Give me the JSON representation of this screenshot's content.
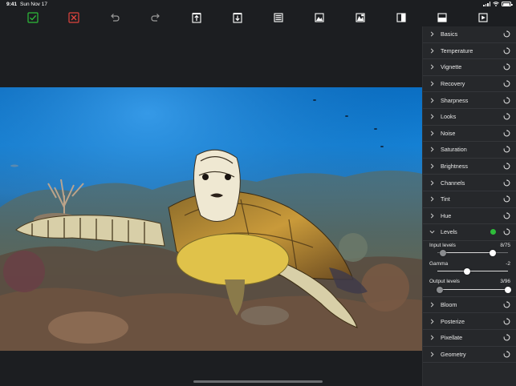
{
  "status_bar": {
    "time": "9:41",
    "date": "Sun Nov 17",
    "battery_level": 0.9
  },
  "toolbar": {
    "buttons": [
      {
        "name": "confirm-button",
        "icon": "checkmark-square-icon",
        "color": "#2ebd3a"
      },
      {
        "name": "cancel-button",
        "icon": "x-square-icon",
        "color": "#e0443e"
      },
      {
        "name": "undo-button",
        "icon": "undo-arrow-icon",
        "color": "#9a9a9a"
      },
      {
        "name": "redo-button",
        "icon": "redo-arrow-icon",
        "color": "#9a9a9a"
      },
      {
        "name": "export-button",
        "icon": "box-arrow-up-icon",
        "color": "#ffffff"
      },
      {
        "name": "import-button",
        "icon": "box-arrow-down-icon",
        "color": "#ffffff"
      },
      {
        "name": "layers-button",
        "icon": "layers-icon",
        "color": "#ffffff"
      },
      {
        "name": "image-button",
        "icon": "image-icon",
        "color": "#ffffff"
      },
      {
        "name": "mask-button",
        "icon": "mask-icon",
        "color": "#ffffff"
      },
      {
        "name": "split-view-button",
        "icon": "split-vertical-icon",
        "color": "#ffffff"
      },
      {
        "name": "compare-button",
        "icon": "split-horizontal-icon",
        "color": "#ffffff"
      },
      {
        "name": "play-button",
        "icon": "play-icon",
        "color": "#ffffff"
      }
    ]
  },
  "panel": {
    "accent_active": "#2ebd3a",
    "rows_top": [
      "Basics",
      "Temperature",
      "Vignette",
      "Recovery",
      "Sharpness",
      "Looks",
      "Noise",
      "Saturation",
      "Brightness",
      "Channels",
      "Tint",
      "Hue"
    ],
    "levels": {
      "label": "Levels",
      "input_levels": {
        "label": "Input levels",
        "value": "8/75",
        "low": 8,
        "high": 75,
        "max": 96
      },
      "gamma": {
        "label": "Gamma",
        "value": "-2",
        "position": 0.42
      },
      "output_levels": {
        "label": "Output levels",
        "value": "3/96",
        "low": 3,
        "high": 96,
        "max": 96
      }
    },
    "rows_bottom": [
      "Bloom",
      "Posterize",
      "Pixellate",
      "Geometry"
    ]
  }
}
